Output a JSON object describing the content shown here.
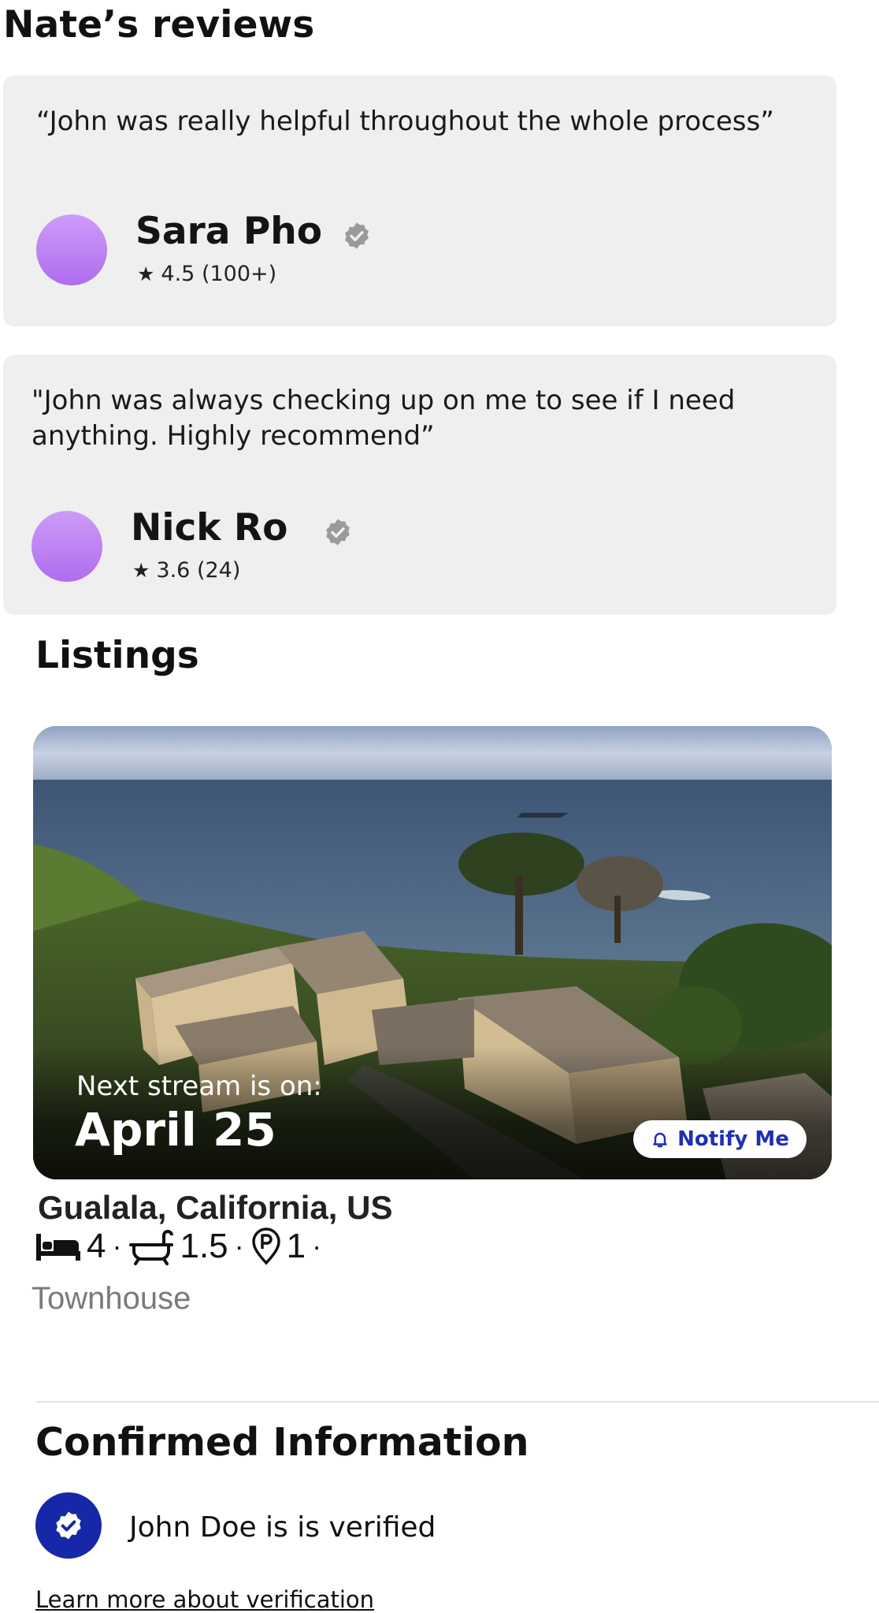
{
  "reviews": {
    "title": "Nate’s reviews",
    "items": [
      {
        "quote": "“John was really helpful throughout the whole process”",
        "name": "Sara Pho",
        "rating": "4.5 (100+)"
      },
      {
        "quote": "\"John was always checking up on me to see if I need anything. Highly recommend”",
        "name": "Nick Ro",
        "rating": "3.6 (24)"
      }
    ]
  },
  "listings": {
    "title": "Listings",
    "card": {
      "stream_label": "Next stream is on:",
      "stream_date": "April 25",
      "notify_label": "Notify Me",
      "location": "Gualala, California, US",
      "beds": "4",
      "baths": "1.5",
      "parking": "1",
      "separator": "·",
      "property_type": "Townhouse"
    }
  },
  "confirmed": {
    "title": "Confirmed Information",
    "verified_text": "John Doe is is verified",
    "learn_more": "Learn more about verification"
  },
  "colors": {
    "card_bg": "#efefef",
    "avatar": "#b87ef3",
    "verified_gray": "#9a9a9a",
    "brand_blue": "#1627a8",
    "notify_text": "#1f2fb4"
  }
}
